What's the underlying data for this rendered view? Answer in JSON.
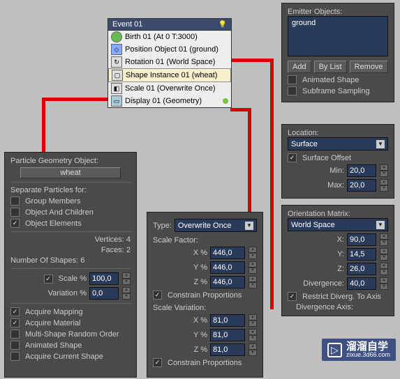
{
  "event_node": {
    "title": "Event 01",
    "ops": [
      {
        "label": "Birth 01 (At 0 T:3000)"
      },
      {
        "label": "Position Object 01 (ground)"
      },
      {
        "label": "Rotation 01 (World Space)"
      },
      {
        "label": "Shape Instance 01 (wheat)"
      },
      {
        "label": "Scale 01 (Overwrite Once)"
      },
      {
        "label": "Display 01 (Geometry)"
      }
    ]
  },
  "emitter": {
    "title": "Emitter Objects:",
    "list_item": "ground",
    "btn_add": "Add",
    "btn_bylist": "By List",
    "btn_remove": "Remove",
    "chk_anim": "Animated Shape",
    "chk_sub": "Subframe Sampling",
    "loc_title": "Location:",
    "loc_value": "Surface",
    "chk_offset": "Surface Offset",
    "min_lbl": "Min:",
    "min_val": "20,0",
    "max_lbl": "Max:",
    "max_val": "20,0"
  },
  "orient": {
    "title": "Orientation Matrix:",
    "value": "World Space",
    "x_lbl": "X:",
    "x_val": "90,0",
    "y_lbl": "Y:",
    "y_val": "14,5",
    "z_lbl": "Z:",
    "z_val": "26,0",
    "div_lbl": "Divergence:",
    "div_val": "40,0",
    "chk_restrict": "Restrict Diverg. To Axis",
    "axis_title": "Divergence Axis:"
  },
  "geom": {
    "title": "Particle Geometry Object:",
    "obj": "wheat",
    "sep_title": "Separate Particles for:",
    "c1": "Group Members",
    "c2": "Object And Children",
    "c3": "Object Elements",
    "stats_v": "Vertices:  4",
    "stats_f": "Faces:  2",
    "stats_n": "Number Of Shapes:  6",
    "scale_lbl": "Scale %",
    "scale_val": "100,0",
    "var_lbl": "Variation %",
    "var_val": "0,0",
    "a1": "Acquire Mapping",
    "a2": "Acquire Material",
    "a3": "Multi-Shape Random Order",
    "a4": "Animated Shape",
    "a5": "Acquire Current Shape"
  },
  "scale": {
    "type_lbl": "Type:",
    "type_val": "Overwrite Once",
    "sf_title": "Scale Factor:",
    "x_lbl": "X %",
    "x_val": "446,0",
    "y_lbl": "Y %",
    "y_val": "446,0",
    "z_lbl": "Z %",
    "z_val": "446,0",
    "cp1": "Constrain Proportions",
    "sv_title": "Scale Variation:",
    "vx_lbl": "X %",
    "vx_val": "81,0",
    "vy_lbl": "Y %",
    "vy_val": "81,0",
    "vz_lbl": "Z %",
    "vz_val": "81,0",
    "cp2": "Constrain Proportions"
  },
  "watermark": {
    "text": "溜溜自学",
    "sub": "zixue.3d66.com"
  }
}
